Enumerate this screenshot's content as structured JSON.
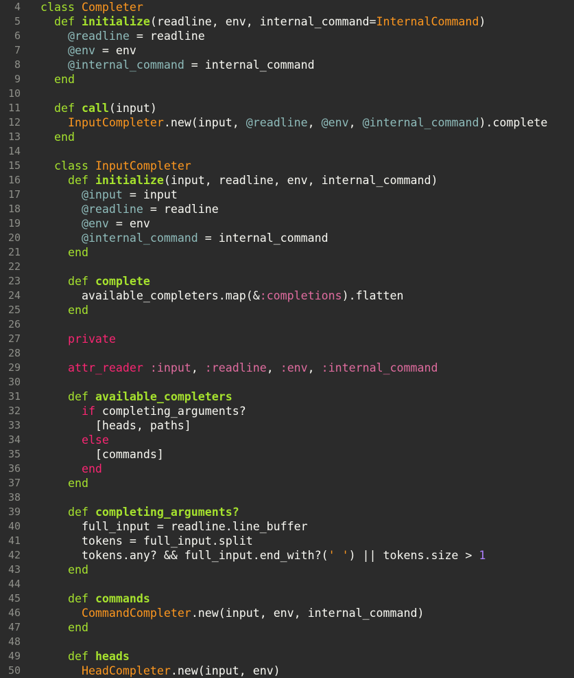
{
  "theme": {
    "background": "#2b2b2b",
    "gutter": "#8f908a",
    "plain": "#f8f8f2",
    "keyword": "#a6e22e",
    "control": "#f92672",
    "constant": "#fd971f",
    "ivar": "#8fbcbb",
    "symbol": "#e06c9f",
    "number": "#ae81ff"
  },
  "lines": [
    {
      "n": "4",
      "tokens": [
        [
          "plain",
          ""
        ],
        [
          "kwdef",
          "class "
        ],
        [
          "const",
          "Completer"
        ]
      ]
    },
    {
      "n": "5",
      "tokens": [
        [
          "plain",
          "  "
        ],
        [
          "kwdef",
          "def "
        ],
        [
          "method",
          "initialize"
        ],
        [
          "plain",
          "(readline, env, internal_command="
        ],
        [
          "const",
          "InternalCommand"
        ],
        [
          "plain",
          ")"
        ]
      ]
    },
    {
      "n": "6",
      "tokens": [
        [
          "plain",
          "    "
        ],
        [
          "ivar",
          "@readline"
        ],
        [
          "plain",
          " = readline"
        ]
      ]
    },
    {
      "n": "7",
      "tokens": [
        [
          "plain",
          "    "
        ],
        [
          "ivar",
          "@env"
        ],
        [
          "plain",
          " = env"
        ]
      ]
    },
    {
      "n": "8",
      "tokens": [
        [
          "plain",
          "    "
        ],
        [
          "ivar",
          "@internal_command"
        ],
        [
          "plain",
          " = internal_command"
        ]
      ]
    },
    {
      "n": "9",
      "tokens": [
        [
          "plain",
          "  "
        ],
        [
          "kwdef",
          "end"
        ]
      ]
    },
    {
      "n": "10",
      "tokens": []
    },
    {
      "n": "11",
      "tokens": [
        [
          "plain",
          "  "
        ],
        [
          "kwdef",
          "def "
        ],
        [
          "method",
          "call"
        ],
        [
          "plain",
          "(input)"
        ]
      ]
    },
    {
      "n": "12",
      "tokens": [
        [
          "plain",
          "    "
        ],
        [
          "const",
          "InputCompleter"
        ],
        [
          "plain",
          ".new(input, "
        ],
        [
          "ivar",
          "@readline"
        ],
        [
          "plain",
          ", "
        ],
        [
          "ivar",
          "@env"
        ],
        [
          "plain",
          ", "
        ],
        [
          "ivar",
          "@internal_command"
        ],
        [
          "plain",
          ").complete"
        ]
      ]
    },
    {
      "n": "13",
      "tokens": [
        [
          "plain",
          "  "
        ],
        [
          "kwdef",
          "end"
        ]
      ]
    },
    {
      "n": "14",
      "tokens": []
    },
    {
      "n": "15",
      "tokens": [
        [
          "plain",
          "  "
        ],
        [
          "kwdef",
          "class "
        ],
        [
          "const",
          "InputCompleter"
        ]
      ]
    },
    {
      "n": "16",
      "tokens": [
        [
          "plain",
          "    "
        ],
        [
          "kwdef",
          "def "
        ],
        [
          "method",
          "initialize"
        ],
        [
          "plain",
          "(input, readline, env, internal_command)"
        ]
      ]
    },
    {
      "n": "17",
      "tokens": [
        [
          "plain",
          "      "
        ],
        [
          "ivar",
          "@input"
        ],
        [
          "plain",
          " = input"
        ]
      ]
    },
    {
      "n": "18",
      "tokens": [
        [
          "plain",
          "      "
        ],
        [
          "ivar",
          "@readline"
        ],
        [
          "plain",
          " = readline"
        ]
      ]
    },
    {
      "n": "19",
      "tokens": [
        [
          "plain",
          "      "
        ],
        [
          "ivar",
          "@env"
        ],
        [
          "plain",
          " = env"
        ]
      ]
    },
    {
      "n": "20",
      "tokens": [
        [
          "plain",
          "      "
        ],
        [
          "ivar",
          "@internal_command"
        ],
        [
          "plain",
          " = internal_command"
        ]
      ]
    },
    {
      "n": "21",
      "tokens": [
        [
          "plain",
          "    "
        ],
        [
          "kwdef",
          "end"
        ]
      ]
    },
    {
      "n": "22",
      "tokens": []
    },
    {
      "n": "23",
      "tokens": [
        [
          "plain",
          "    "
        ],
        [
          "kwdef",
          "def "
        ],
        [
          "method",
          "complete"
        ]
      ]
    },
    {
      "n": "24",
      "tokens": [
        [
          "plain",
          "      available_completers.map(&"
        ],
        [
          "symbol",
          ":completions"
        ],
        [
          "plain",
          ").flatten"
        ]
      ]
    },
    {
      "n": "25",
      "tokens": [
        [
          "plain",
          "    "
        ],
        [
          "kwdef",
          "end"
        ]
      ]
    },
    {
      "n": "26",
      "tokens": []
    },
    {
      "n": "27",
      "tokens": [
        [
          "plain",
          "    "
        ],
        [
          "control",
          "private"
        ]
      ]
    },
    {
      "n": "28",
      "tokens": []
    },
    {
      "n": "29",
      "tokens": [
        [
          "plain",
          "    "
        ],
        [
          "control",
          "attr_reader "
        ],
        [
          "symbol",
          ":input"
        ],
        [
          "plain",
          ", "
        ],
        [
          "symbol",
          ":readline"
        ],
        [
          "plain",
          ", "
        ],
        [
          "symbol",
          ":env"
        ],
        [
          "plain",
          ", "
        ],
        [
          "symbol",
          ":internal_command"
        ]
      ]
    },
    {
      "n": "30",
      "tokens": []
    },
    {
      "n": "31",
      "tokens": [
        [
          "plain",
          "    "
        ],
        [
          "kwdef",
          "def "
        ],
        [
          "method",
          "available_completers"
        ]
      ]
    },
    {
      "n": "32",
      "tokens": [
        [
          "plain",
          "      "
        ],
        [
          "control",
          "if"
        ],
        [
          "plain",
          " completing_arguments?"
        ]
      ]
    },
    {
      "n": "33",
      "tokens": [
        [
          "plain",
          "        [heads, paths]"
        ]
      ]
    },
    {
      "n": "34",
      "tokens": [
        [
          "plain",
          "      "
        ],
        [
          "control",
          "else"
        ]
      ]
    },
    {
      "n": "35",
      "tokens": [
        [
          "plain",
          "        [commands]"
        ]
      ]
    },
    {
      "n": "36",
      "tokens": [
        [
          "plain",
          "      "
        ],
        [
          "control",
          "end"
        ]
      ]
    },
    {
      "n": "37",
      "tokens": [
        [
          "plain",
          "    "
        ],
        [
          "kwdef",
          "end"
        ]
      ]
    },
    {
      "n": "38",
      "tokens": []
    },
    {
      "n": "39",
      "tokens": [
        [
          "plain",
          "    "
        ],
        [
          "kwdef",
          "def "
        ],
        [
          "method",
          "completing_arguments?"
        ]
      ]
    },
    {
      "n": "40",
      "tokens": [
        [
          "plain",
          "      full_input = readline.line_buffer"
        ]
      ]
    },
    {
      "n": "41",
      "tokens": [
        [
          "plain",
          "      tokens = full_input.split"
        ]
      ]
    },
    {
      "n": "42",
      "tokens": [
        [
          "plain",
          "      tokens.any? && full_input.end_with?("
        ],
        [
          "string",
          "' '"
        ],
        [
          "plain",
          ") || tokens.size > "
        ],
        [
          "number",
          "1"
        ]
      ]
    },
    {
      "n": "43",
      "tokens": [
        [
          "plain",
          "    "
        ],
        [
          "kwdef",
          "end"
        ]
      ]
    },
    {
      "n": "44",
      "tokens": []
    },
    {
      "n": "45",
      "tokens": [
        [
          "plain",
          "    "
        ],
        [
          "kwdef",
          "def "
        ],
        [
          "method",
          "commands"
        ]
      ]
    },
    {
      "n": "46",
      "tokens": [
        [
          "plain",
          "      "
        ],
        [
          "const",
          "CommandCompleter"
        ],
        [
          "plain",
          ".new(input, env, internal_command)"
        ]
      ]
    },
    {
      "n": "47",
      "tokens": [
        [
          "plain",
          "    "
        ],
        [
          "kwdef",
          "end"
        ]
      ]
    },
    {
      "n": "48",
      "tokens": []
    },
    {
      "n": "49",
      "tokens": [
        [
          "plain",
          "    "
        ],
        [
          "kwdef",
          "def "
        ],
        [
          "method",
          "heads"
        ]
      ]
    },
    {
      "n": "50",
      "tokens": [
        [
          "plain",
          "      "
        ],
        [
          "const",
          "HeadCompleter"
        ],
        [
          "plain",
          ".new(input, env)"
        ]
      ]
    }
  ]
}
